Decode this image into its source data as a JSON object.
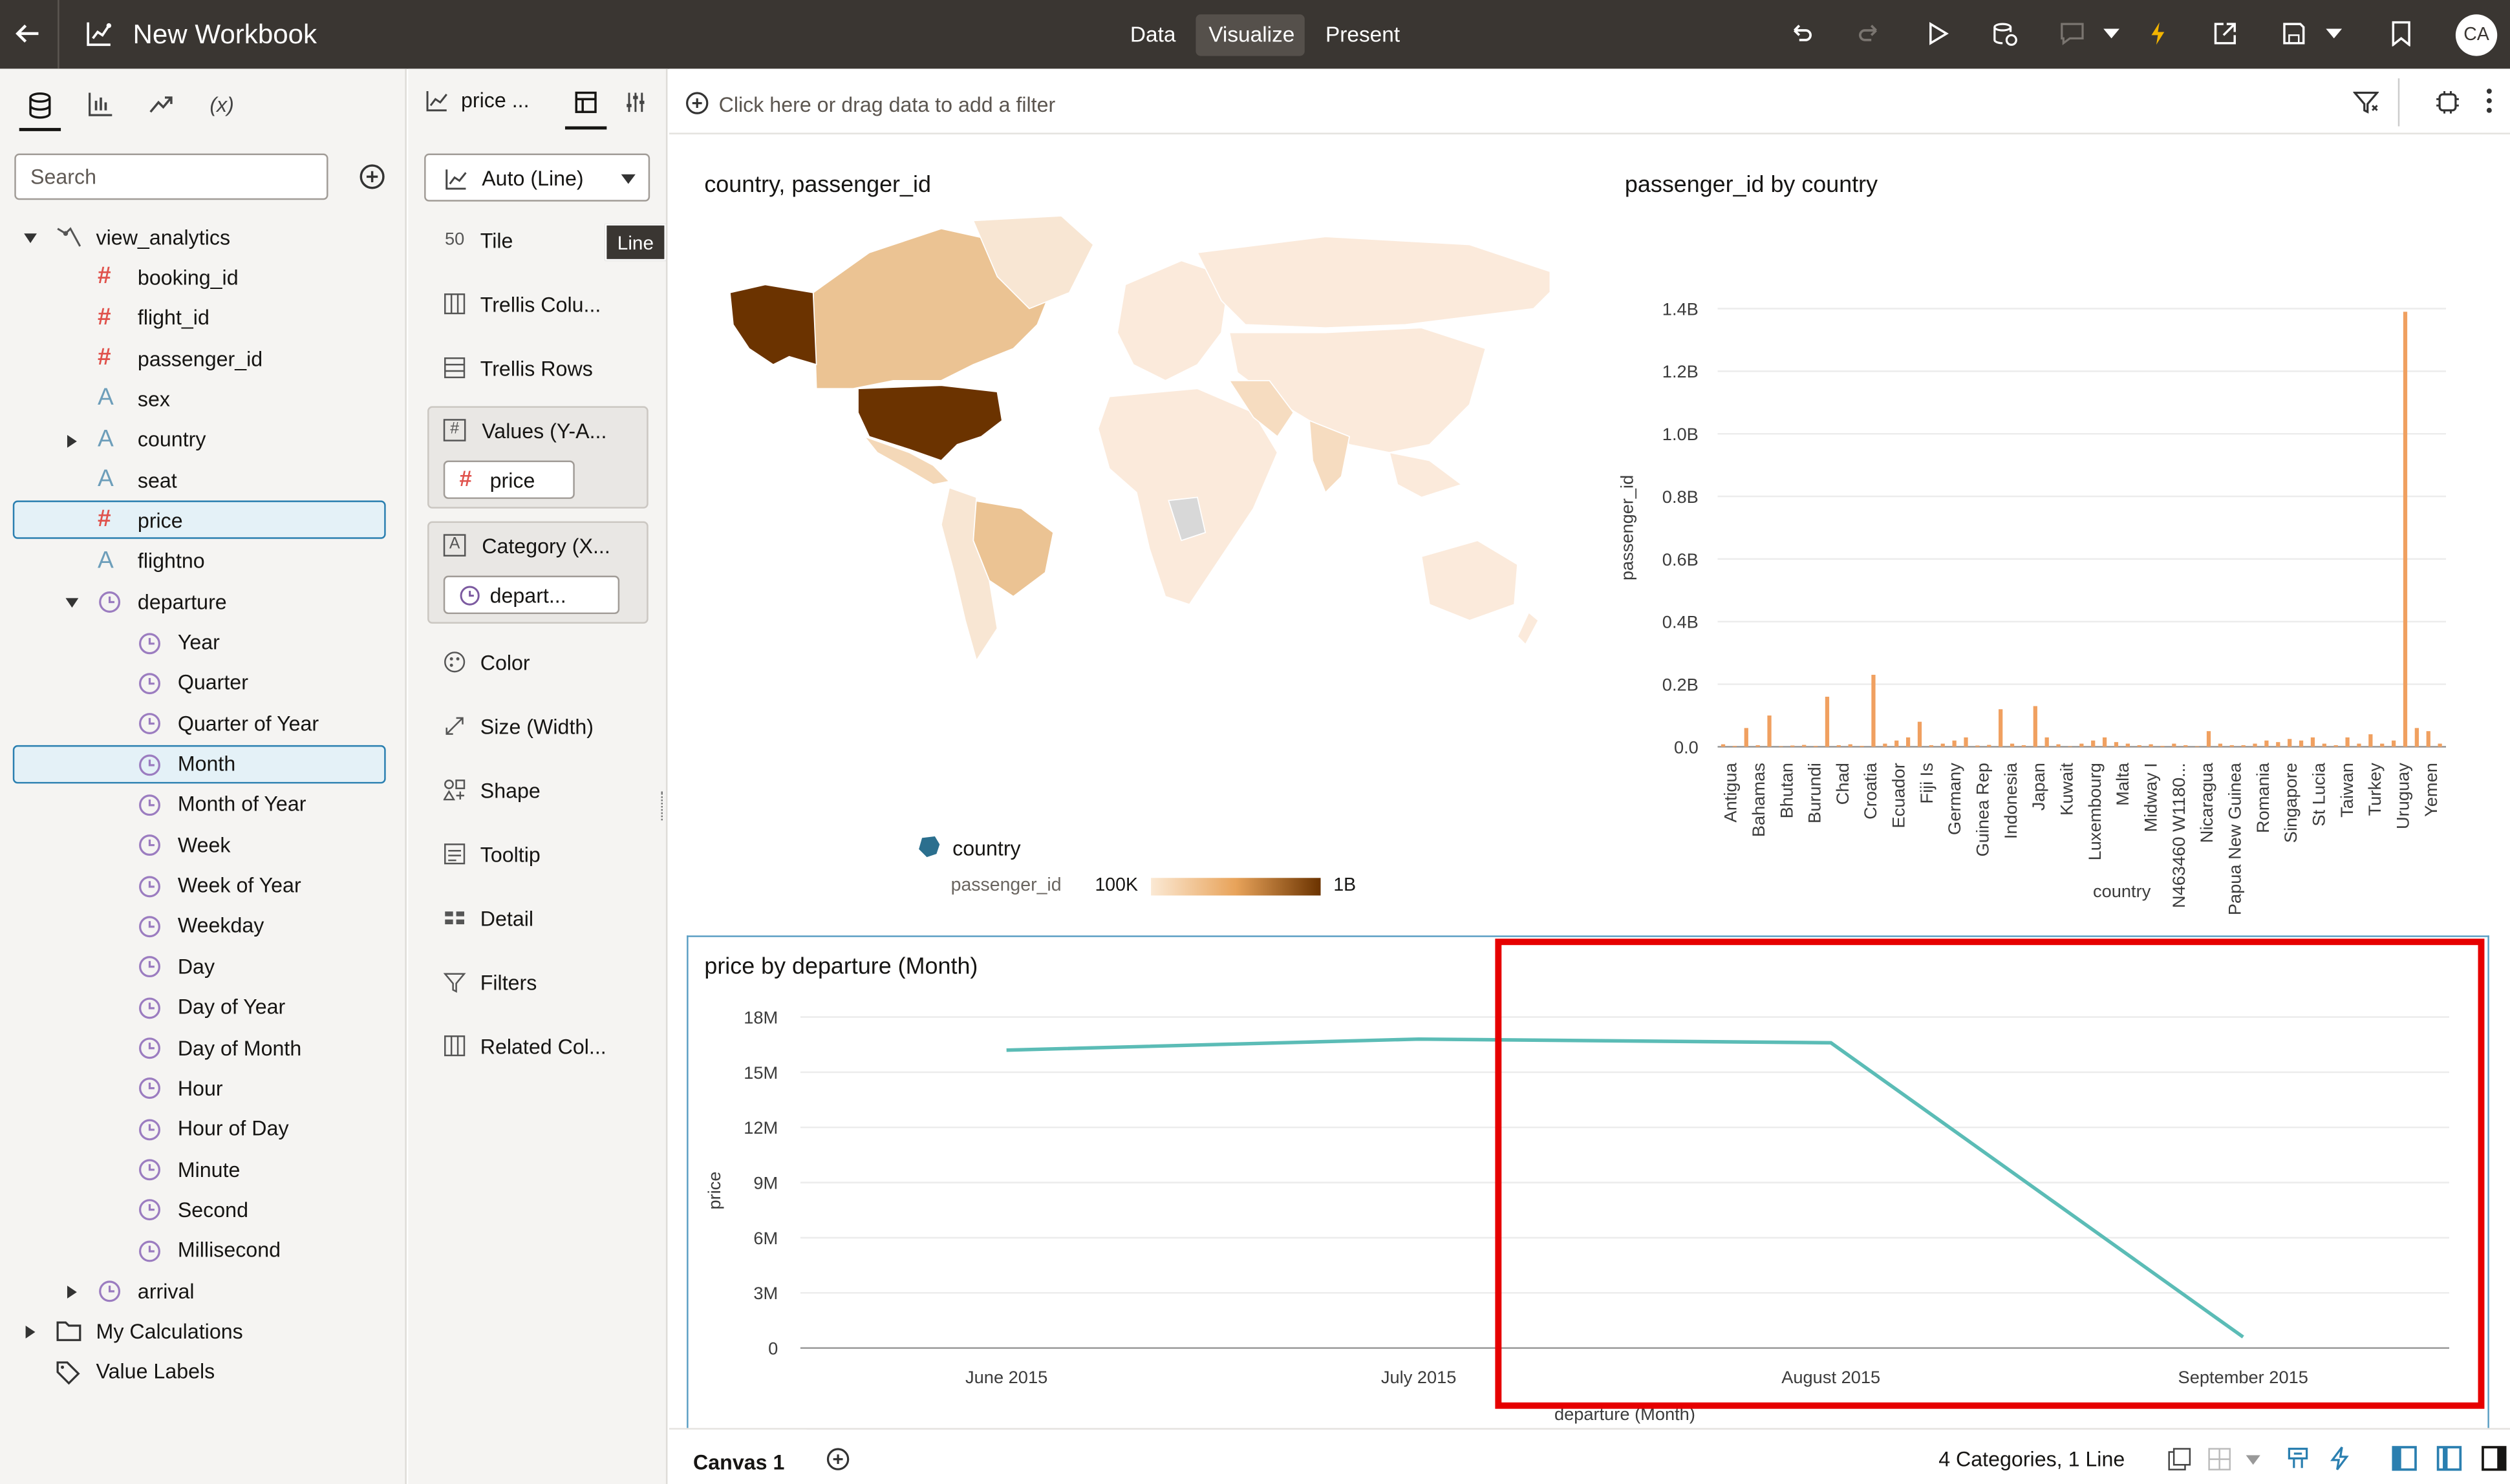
{
  "topbar": {
    "title": "New Workbook",
    "tabs": [
      "Data",
      "Visualize",
      "Present"
    ],
    "active_tab": "Visualize",
    "avatar": "CA"
  },
  "left_panel": {
    "tabs": [
      "data-icon",
      "chart-icon",
      "analytics-icon",
      "(x)"
    ],
    "search_placeholder": "Search",
    "tree": [
      {
        "label": "view_analytics",
        "type": "subject-area",
        "expanded": true
      },
      {
        "label": "booking_id",
        "type": "measure"
      },
      {
        "label": "flight_id",
        "type": "measure"
      },
      {
        "label": "passenger_id",
        "type": "measure"
      },
      {
        "label": "sex",
        "type": "attribute"
      },
      {
        "label": "country",
        "type": "attribute"
      },
      {
        "label": "seat",
        "type": "attribute"
      },
      {
        "label": "price",
        "type": "measure",
        "selected": true
      },
      {
        "label": "flightno",
        "type": "attribute"
      },
      {
        "label": "departure",
        "type": "time",
        "expanded": true
      },
      {
        "label": "Year",
        "type": "time-level"
      },
      {
        "label": "Quarter",
        "type": "time-level"
      },
      {
        "label": "Quarter of Year",
        "type": "time-level"
      },
      {
        "label": "Month",
        "type": "time-level",
        "selected": true
      },
      {
        "label": "Month of Year",
        "type": "time-level"
      },
      {
        "label": "Week",
        "type": "time-level"
      },
      {
        "label": "Week of Year",
        "type": "time-level"
      },
      {
        "label": "Weekday",
        "type": "time-level"
      },
      {
        "label": "Day",
        "type": "time-level"
      },
      {
        "label": "Day of Year",
        "type": "time-level"
      },
      {
        "label": "Day of Month",
        "type": "time-level"
      },
      {
        "label": "Hour",
        "type": "time-level"
      },
      {
        "label": "Hour of Day",
        "type": "time-level"
      },
      {
        "label": "Minute",
        "type": "time-level"
      },
      {
        "label": "Second",
        "type": "time-level"
      },
      {
        "label": "Millisecond",
        "type": "time-level"
      },
      {
        "label": "arrival",
        "type": "time"
      },
      {
        "label": "My Calculations",
        "type": "folder"
      },
      {
        "label": "Value Labels",
        "type": "tag"
      }
    ]
  },
  "grammar_panel": {
    "viz_name": "price ...",
    "viz_type": "Auto (Line)",
    "tooltip": "Line",
    "tile": "Tile",
    "trellis_columns": "Trellis Colu...",
    "trellis_rows": "Trellis Rows",
    "values_label": "Values (Y-A...",
    "values_pill": "price",
    "category_label": "Category (X...",
    "category_pill": "depart...",
    "color": "Color",
    "size": "Size (Width)",
    "shape": "Shape",
    "tooltip_item": "Tooltip",
    "detail": "Detail",
    "filters": "Filters",
    "related": "Related Col..."
  },
  "filter_bar": {
    "placeholder": "Click here or drag data to add a filter"
  },
  "map_viz": {
    "title": "country, passenger_id",
    "legend_title": "country",
    "legend_measure": "passenger_id",
    "legend_min": "100K",
    "legend_max": "1B"
  },
  "bar_viz": {
    "title": "passenger_id by country",
    "ylabel": "passenger_id",
    "xlabel": "country"
  },
  "line_viz": {
    "title": "price by departure (Month)",
    "ylabel": "price",
    "xlabel": "departure (Month)"
  },
  "footer": {
    "canvas_tab": "Canvas 1",
    "summary": "4 Categories, 1 Line"
  },
  "chart_data": [
    {
      "type": "bar",
      "title": "passenger_id by country",
      "xlabel": "country",
      "ylabel": "passenger_id",
      "ylim": [
        0,
        1400000000
      ],
      "y_ticks": [
        "0.0",
        "0.2B",
        "0.4B",
        "0.6B",
        "0.8B",
        "1.0B",
        "1.2B",
        "1.4B"
      ],
      "grid": true,
      "x_tick_labels": [
        "Antigua",
        "Bahamas",
        "Bhutan",
        "Burundi",
        "Chad",
        "Croatia",
        "Ecuador",
        "Fiji Is",
        "Germany",
        "Guinea Rep",
        "Indonesia",
        "Japan",
        "Kuwait",
        "Luxembourg",
        "Malta",
        "Midway I",
        "N463460 W1180...",
        "Nicaragua",
        "Papua New Guinea",
        "Romania",
        "Singapore",
        "St Lucia",
        "Taiwan",
        "Turkey",
        "Uruguay",
        "Yemen"
      ],
      "values": [
        8000000,
        3000000,
        60000000,
        5000000,
        100000000,
        2000000,
        4000000,
        6000000,
        3000000,
        160000000,
        5000000,
        8000000,
        3000000,
        230000000,
        10000000,
        20000000,
        30000000,
        80000000,
        5000000,
        10000000,
        20000000,
        30000000,
        4000000,
        6000000,
        120000000,
        10000000,
        5000000,
        130000000,
        30000000,
        8000000,
        2000000,
        10000000,
        20000000,
        30000000,
        15000000,
        10000000,
        5000000,
        8000000,
        3000000,
        10000000,
        5000000,
        2000000,
        50000000,
        10000000,
        5000000,
        5000000,
        10000000,
        20000000,
        15000000,
        25000000,
        20000000,
        30000000,
        10000000,
        5000000,
        30000000,
        10000000,
        40000000,
        10000000,
        20000000,
        1390000000,
        60000000,
        50000000,
        10000000
      ]
    },
    {
      "type": "line",
      "title": "price by departure (Month)",
      "xlabel": "departure (Month)",
      "ylabel": "price",
      "categories": [
        "June 2015",
        "July 2015",
        "August 2015",
        "September 2015"
      ],
      "values": [
        16200000,
        16800000,
        16600000,
        600000
      ],
      "ylim": [
        0,
        18000000
      ],
      "y_ticks": [
        "0",
        "3M",
        "6M",
        "9M",
        "12M",
        "15M",
        "18M"
      ],
      "grid": true,
      "color": "#5bbcb6"
    },
    {
      "type": "map",
      "title": "country, passenger_id",
      "legend": {
        "title": "country",
        "measure": "passenger_id",
        "min": "100K",
        "max": "1B"
      },
      "color_low": "#f6e2c8",
      "color_high": "#6b3300"
    }
  ],
  "colors": {
    "accent": "#2a7fb0",
    "bar": "#f0a060",
    "line": "#5bbcb6",
    "highlight": "#e60000"
  }
}
